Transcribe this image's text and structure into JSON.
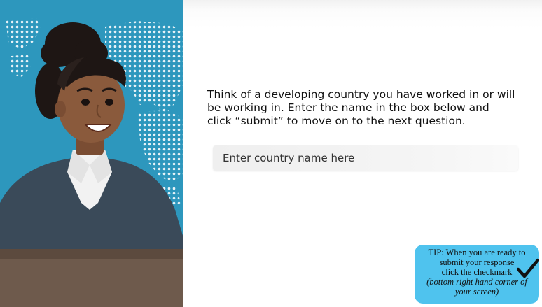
{
  "prompt": {
    "line1": "Think of a developing country you have worked in or will",
    "line2": "be working in. Enter the name in the box below and",
    "line3": "click “submit” to move on to the next question."
  },
  "input": {
    "placeholder": "Enter country name here",
    "value": ""
  },
  "tip": {
    "line1": "TIP: When you are ready to",
    "line2": "submit your response",
    "line3": "click the checkmark",
    "line4": "(bottom right hand corner of",
    "line5": "your screen)"
  },
  "icons": {
    "checkmark": "checkmark-icon"
  },
  "colors": {
    "map_background": "#2d97bd",
    "tip_background": "#4fc3ee",
    "jacket": "#3a4a59",
    "skin": "#8a5a3c",
    "hair": "#1e1614"
  }
}
